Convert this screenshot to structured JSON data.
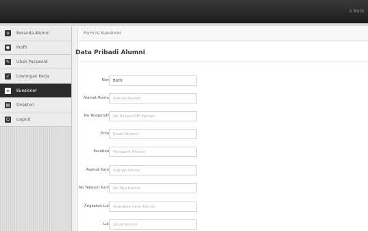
{
  "header": {
    "user": "BUDI"
  },
  "sidebar": {
    "items": [
      {
        "label": "Beranda Alumni",
        "icon": "home-icon",
        "glyph": "⌂"
      },
      {
        "label": "Profil",
        "icon": "user-icon",
        "glyph": "●"
      },
      {
        "label": "Ubah Password",
        "icon": "key-icon",
        "glyph": "✎"
      },
      {
        "label": "Lowongan Kerja",
        "icon": "briefcase-icon",
        "glyph": "✓"
      },
      {
        "label": "Kuesioner",
        "icon": "list-icon",
        "glyph": "≡"
      },
      {
        "label": "Direktori",
        "icon": "book-icon",
        "glyph": "▤"
      },
      {
        "label": "Logout",
        "icon": "logout-icon",
        "glyph": "⏻"
      }
    ],
    "active_index": 4
  },
  "breadcrumb": "Form Isi Kuesioner",
  "form": {
    "title": "Data Pribadi Alumni",
    "fields": [
      {
        "label": "Nama",
        "value": "BUDI",
        "placeholder": ""
      },
      {
        "label": "Alamat Rumah*",
        "value": "",
        "placeholder": "Alamat Rumah"
      },
      {
        "label": "No Telepon/HP*",
        "value": "",
        "placeholder": "No Telepon/HP Rumah"
      },
      {
        "label": "Email*",
        "value": "",
        "placeholder": "Email Alumni"
      },
      {
        "label": "Facebook*",
        "value": "",
        "placeholder": "Facebook Alumni"
      },
      {
        "label": "Alamat Kantor",
        "value": "",
        "placeholder": "Alamat Kantor"
      },
      {
        "label": "No Telepon Kantor",
        "value": "",
        "placeholder": "No Telp Kantor"
      },
      {
        "label": "Angkatan Lulus",
        "value": "",
        "placeholder": "Angkatan lulus Alumni"
      },
      {
        "label": "Lulus",
        "value": "",
        "placeholder": "Lulus Alumni"
      }
    ]
  }
}
